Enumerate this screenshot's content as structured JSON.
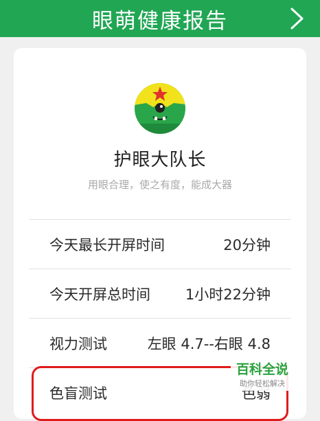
{
  "header": {
    "title": "眼萌健康报告",
    "next_icon": "chevron-right-icon"
  },
  "profile": {
    "avatar_icon": "one-eyed-monster-avatar-icon",
    "name": "护眼大队长",
    "slogan": "用眼合理，使之有度，能成大器"
  },
  "stats": [
    {
      "label": "今天最长开屏时间",
      "value": "20分钟"
    },
    {
      "label": "今天开屏总时间",
      "value": "1小时22分钟"
    },
    {
      "label": "视力测试",
      "value": "左眼 4.7--右眼 4.8"
    },
    {
      "label": "色盲测试",
      "value": "色弱"
    }
  ],
  "watermark": {
    "title": "百科全说",
    "subtitle": "助你轻松解决"
  },
  "colors": {
    "header_green": "#21a654",
    "highlight_red": "#e01a1a",
    "watermark_green": "#2aa33f"
  }
}
